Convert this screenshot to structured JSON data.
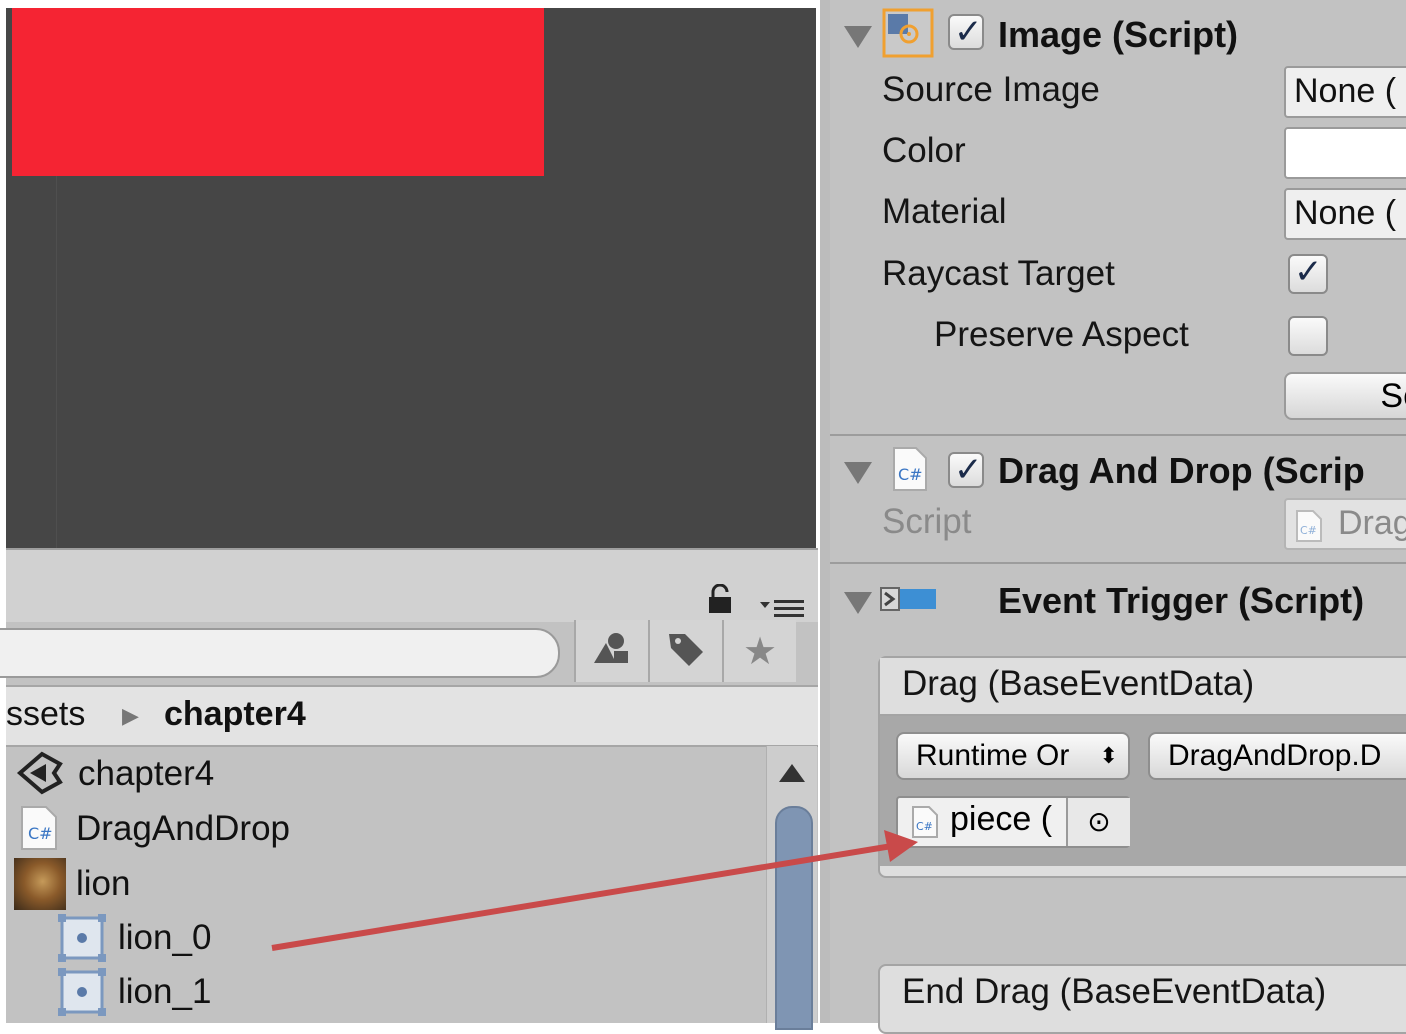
{
  "inspector": {
    "image_component": {
      "title": "Image (Script)",
      "fields": {
        "source_image_label": "Source Image",
        "source_image_value": "None (",
        "color_label": "Color",
        "material_label": "Material",
        "material_value": "None (",
        "raycast_label": "Raycast Target",
        "preserve_label": "Preserve Aspect",
        "set_native_button": "Se"
      }
    },
    "dragdrop_component": {
      "title": "Drag And Drop (Scrip",
      "script_label": "Script",
      "script_value": "Drag"
    },
    "event_trigger": {
      "title": "Event Trigger (Script)",
      "drag_event": "Drag (BaseEventData)",
      "runtime_dropdown": "Runtime Or",
      "function_dropdown": "DragAndDrop.D",
      "object_value": "piece (",
      "end_drag_event": "End Drag (BaseEventData)"
    }
  },
  "project": {
    "breadcrumb_parent": "ssets",
    "breadcrumb_current": "chapter4",
    "items": [
      {
        "label": "chapter4",
        "icon": "unity-scene-icon"
      },
      {
        "label": "DragAndDrop",
        "icon": "csharp-script-icon"
      },
      {
        "label": "lion",
        "icon": "texture-thumbnail-icon"
      },
      {
        "label": "lion_0",
        "icon": "sprite-icon"
      },
      {
        "label": "lion_1",
        "icon": "sprite-icon"
      }
    ]
  },
  "colors": {
    "scene_background": "#464646",
    "red_rect": "#f52433",
    "arrow": "#c94a4a",
    "checkbox_tick": "#1b2b4a"
  }
}
